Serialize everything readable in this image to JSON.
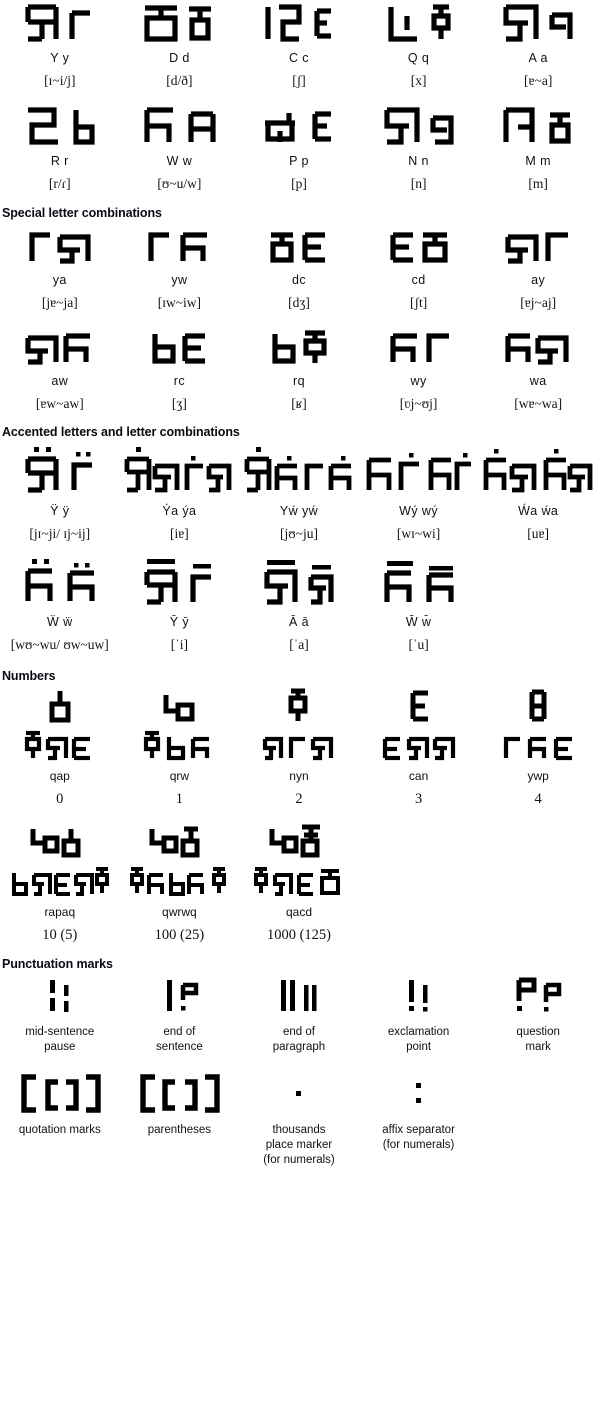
{
  "sections": {
    "letters": {
      "title": "",
      "rows": [
        [
          {
            "glyph": "yy",
            "latin": "Y y",
            "ipa": "[ɪ~i/j]"
          },
          {
            "glyph": "dd",
            "latin": "D d",
            "ipa": "[d/ð]"
          },
          {
            "glyph": "cc",
            "latin": "C c",
            "ipa": "[ʃ]"
          },
          {
            "glyph": "qq",
            "latin": "Q q",
            "ipa": "[x]"
          },
          {
            "glyph": "aa",
            "latin": "A a",
            "ipa": "[ɐ~a]"
          }
        ],
        [
          {
            "glyph": "rr",
            "latin": "R r",
            "ipa": "[r/ɾ]"
          },
          {
            "glyph": "ww",
            "latin": "W w",
            "ipa": "[ʊ~u/w]"
          },
          {
            "glyph": "pp",
            "latin": "P p",
            "ipa": "[p]"
          },
          {
            "glyph": "nn",
            "latin": "N n",
            "ipa": "[n]"
          },
          {
            "glyph": "mm",
            "latin": "M m",
            "ipa": "[m]"
          }
        ]
      ]
    },
    "combinations": {
      "title": "Special letter combinations",
      "rows": [
        [
          {
            "glyph": "ya",
            "latin": "ya",
            "ipa": "[jɐ~ja]"
          },
          {
            "glyph": "yw",
            "latin": "yw",
            "ipa": "[ɪw~iw]"
          },
          {
            "glyph": "dc",
            "latin": "dc",
            "ipa": "[dʒ]"
          },
          {
            "glyph": "cd",
            "latin": "cd",
            "ipa": "[ʃt]"
          },
          {
            "glyph": "ay",
            "latin": "ay",
            "ipa": "[ɐj~aj]"
          }
        ],
        [
          {
            "glyph": "aw",
            "latin": "aw",
            "ipa": "[ɐw~aw]"
          },
          {
            "glyph": "rc",
            "latin": "rc",
            "ipa": "[ʒ]"
          },
          {
            "glyph": "rq",
            "latin": "rq",
            "ipa": "[ʁ]"
          },
          {
            "glyph": "wy",
            "latin": "wy",
            "ipa": "[ʋj~ʊj]"
          },
          {
            "glyph": "wa",
            "latin": "wa",
            "ipa": "[wɐ~wa]"
          }
        ]
      ]
    },
    "accented": {
      "title": "Accented letters and letter combinations",
      "rows": [
        [
          {
            "glyph": "Y_diaer",
            "latin": "Ÿ ÿ",
            "ipa": "[jɪ~ji/ ɪj~ij]"
          },
          {
            "glyph": "Ya_acute",
            "latin": "Ýa ýa",
            "ipa": "[iɐ]"
          },
          {
            "glyph": "Yw_acute",
            "latin": "Yẃ yẃ",
            "ipa": "[jʊ~ju]"
          },
          {
            "glyph": "Wy_acute",
            "latin": "Wý wý",
            "ipa": "[wɪ~wi]"
          },
          {
            "glyph": "Wa_acute",
            "latin": "Ẃa ẃa",
            "ipa": "[uɐ]"
          }
        ],
        [
          {
            "glyph": "W_diaer",
            "latin": "Ẅ ẅ",
            "ipa": "[wʊ~wu/ ʊw~uw]"
          },
          {
            "glyph": "Y_macron",
            "latin": "Ȳ ȳ",
            "ipa": "[ˈi]"
          },
          {
            "glyph": "A_macron",
            "latin": "Ā ā",
            "ipa": "[ˈa]"
          },
          {
            "glyph": "W_macron",
            "latin": "W̄ w̄",
            "ipa": "[ˈu]"
          },
          {
            "glyph": "",
            "latin": "",
            "ipa": ""
          }
        ]
      ]
    },
    "numbers": {
      "title": "Numbers",
      "rows": [
        [
          {
            "glyph": "n0",
            "word": "w_qap",
            "translit": "qap",
            "value": "0"
          },
          {
            "glyph": "n1",
            "word": "w_qrw",
            "translit": "qrw",
            "value": "1"
          },
          {
            "glyph": "n2",
            "word": "w_nyn",
            "translit": "nyn",
            "value": "2"
          },
          {
            "glyph": "n3",
            "word": "w_can",
            "translit": "can",
            "value": "3"
          },
          {
            "glyph": "n4",
            "word": "w_ywp",
            "translit": "ywp",
            "value": "4"
          }
        ],
        [
          {
            "glyph": "n10",
            "word": "w_rapaq",
            "translit": "rapaq",
            "value": "10 (5)"
          },
          {
            "glyph": "n100",
            "word": "w_qwrwq",
            "translit": "qwrwq",
            "value": "100 (25)"
          },
          {
            "glyph": "n1000",
            "word": "w_qacd",
            "translit": "qacd",
            "value": "1000 (125)"
          },
          {
            "glyph": "",
            "word": "",
            "translit": "",
            "value": ""
          },
          {
            "glyph": "",
            "word": "",
            "translit": "",
            "value": ""
          }
        ]
      ]
    },
    "punctuation": {
      "title": "Punctuation marks",
      "rows": [
        [
          {
            "glyph": "p_pause",
            "label": "mid-sentence\npause"
          },
          {
            "glyph": "p_eos",
            "label": "end of\nsentence"
          },
          {
            "glyph": "p_eop",
            "label": "end of\nparagraph"
          },
          {
            "glyph": "p_excl",
            "label": "exclamation\npoint"
          },
          {
            "glyph": "p_quest",
            "label": "question\nmark"
          }
        ],
        [
          {
            "glyph": "p_quote",
            "label": "quotation marks"
          },
          {
            "glyph": "p_paren",
            "label": "parentheses"
          },
          {
            "glyph": "p_thousands",
            "label": "thousands\nplace marker\n(for numerals)"
          },
          {
            "glyph": "p_affix",
            "label": "affix separator\n(for numerals)"
          },
          {
            "glyph": "",
            "label": ""
          }
        ]
      ]
    }
  },
  "colors": {
    "ink": "#000000",
    "text": "#111111",
    "heading": "#0a0a14",
    "background": "#ffffff"
  }
}
